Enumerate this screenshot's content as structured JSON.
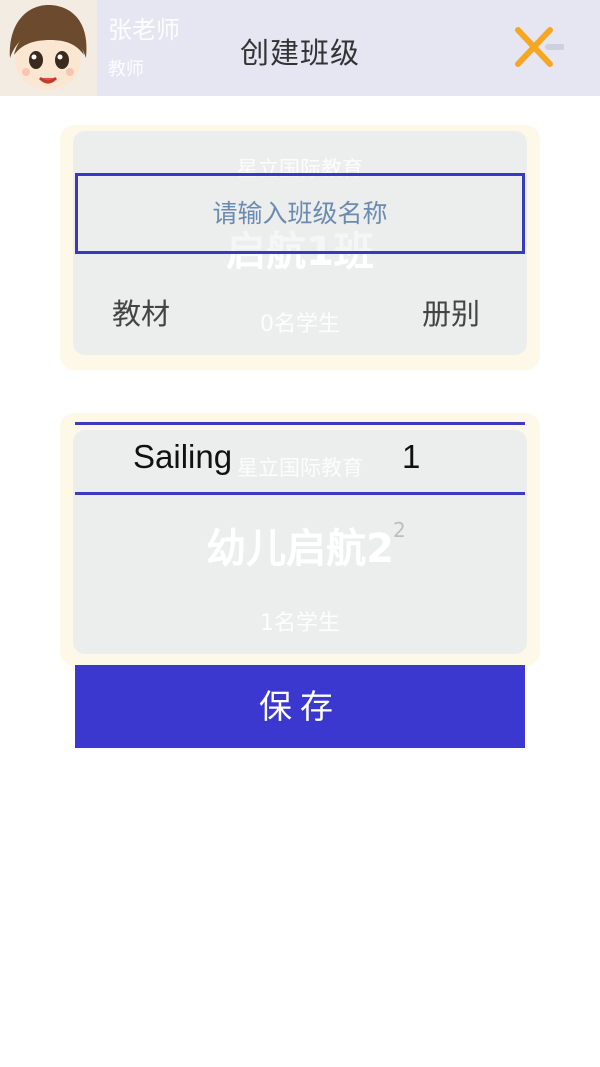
{
  "header": {
    "user_name": "张老师",
    "user_role": "教师",
    "title": "创建班级",
    "close_icon": "close-x-icon",
    "accent_color": "#f5a623"
  },
  "card1": {
    "school": "星立国际教育",
    "class_name": "启航1班",
    "student_count": "0名学生"
  },
  "card2": {
    "school": "星立国际教育",
    "class_name": "幼儿启航2",
    "superscript": "2",
    "student_count": "1名学生"
  },
  "form": {
    "class_name_placeholder": "请输入班级名称",
    "class_name_value": "",
    "material_label": "教材",
    "volume_label": "册别",
    "selected_material": "Sailing",
    "selected_volume": "1",
    "save_label": "保存"
  },
  "colors": {
    "primary": "#3b38cf",
    "header_bg": "#e6e6f3",
    "card_bg": "#eceeee"
  }
}
